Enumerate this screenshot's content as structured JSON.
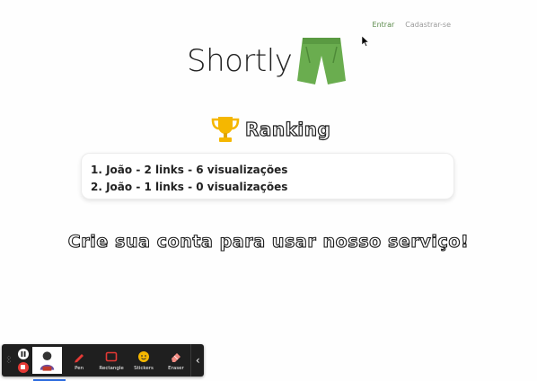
{
  "nav": {
    "login": "Entrar",
    "signup": "Cadastrar-se"
  },
  "brand": {
    "title": "Shortly",
    "logo_icon": "shorts-icon",
    "logo_color": "#6aad4f"
  },
  "ranking": {
    "title": "Ranking",
    "icon": "trophy-icon",
    "items": [
      "1. João - 2 links - 6 visualizações",
      "2. João - 1 links - 0 visualizações"
    ]
  },
  "cta": {
    "text": "Crie sua conta para usar nosso serviço!"
  },
  "recorder_toolbar": {
    "tools": [
      {
        "label": "Pen",
        "icon": "pen-icon",
        "color": "#e53935"
      },
      {
        "label": "Rectangle",
        "icon": "rectangle-icon",
        "color": "#e53935"
      },
      {
        "label": "Stickers",
        "icon": "sticker-icon",
        "color": "#f5b700"
      },
      {
        "label": "Eraser",
        "icon": "eraser-icon",
        "color": "#f28b82"
      }
    ],
    "collapse_glyph": "‹"
  }
}
